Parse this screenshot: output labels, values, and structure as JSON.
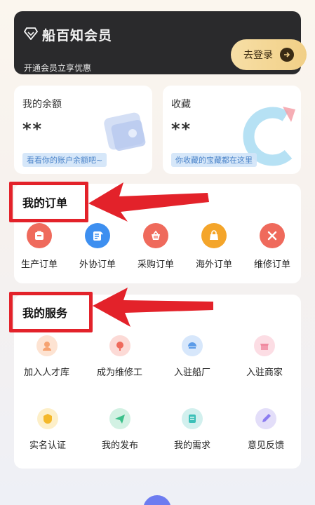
{
  "vip": {
    "title": "船百知会员",
    "subtitle": "开通会员立享优惠",
    "login_label": "去登录"
  },
  "balance": {
    "label": "我的余额",
    "value": "**",
    "hint": "看看你的账户余额吧~"
  },
  "favorites": {
    "label": "收藏",
    "value": "**",
    "hint": "你收藏的宝藏都在这里"
  },
  "orders": {
    "title": "我的订单",
    "items": [
      {
        "label": "生产订单",
        "icon": "production-order-icon",
        "color": "#ef6a5c"
      },
      {
        "label": "外协订单",
        "icon": "outsource-order-icon",
        "color": "#3d8ff0"
      },
      {
        "label": "采购订单",
        "icon": "purchase-order-icon",
        "color": "#ef6a5c"
      },
      {
        "label": "海外订单",
        "icon": "overseas-order-icon",
        "color": "#f4a52a"
      },
      {
        "label": "维修订单",
        "icon": "repair-order-icon",
        "color": "#ef6a5c"
      }
    ]
  },
  "services": {
    "title": "我的服务",
    "items": [
      {
        "label": "加入人才库",
        "icon": "talent-pool-icon",
        "color": "#f6a371"
      },
      {
        "label": "成为维修工",
        "icon": "repairman-icon",
        "color": "#ef6a5c"
      },
      {
        "label": "入驻船厂",
        "icon": "shipyard-icon",
        "color": "#5b9be8"
      },
      {
        "label": "入驻商家",
        "icon": "merchant-icon",
        "color": "#f08aa0"
      },
      {
        "label": "实名认证",
        "icon": "verification-icon",
        "color": "#f4b82a"
      },
      {
        "label": "我的发布",
        "icon": "my-posts-icon",
        "color": "#3cc08a"
      },
      {
        "label": "我的需求",
        "icon": "my-demands-icon",
        "color": "#3cc0b8"
      },
      {
        "label": "意见反馈",
        "icon": "feedback-icon",
        "color": "#8b7cf0"
      }
    ]
  },
  "colors": {
    "annotation_red": "#e3222a",
    "vip_gold": "#f1cf86"
  }
}
